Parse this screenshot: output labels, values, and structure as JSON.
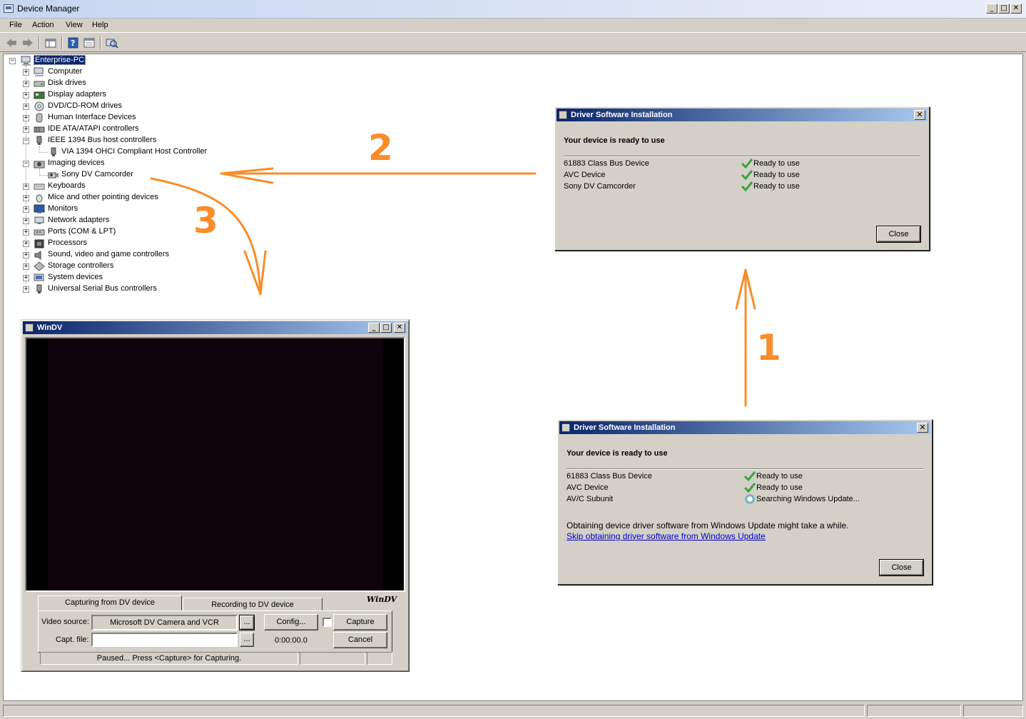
{
  "window": {
    "title": "Device Manager",
    "buttons": {
      "minimize": "_",
      "maximize": "□",
      "close": "✕"
    }
  },
  "menu": [
    "File",
    "Action",
    "View",
    "Help"
  ],
  "toolbar": [
    "back-icon",
    "forward-icon",
    "show-hide-tree-icon",
    "help-icon",
    "properties-icon",
    "scan-hardware-icon"
  ],
  "tree": {
    "root": "Enterprise-PC",
    "items": [
      {
        "label": "Computer",
        "icon": "computer-icon"
      },
      {
        "label": "Disk drives",
        "icon": "disk-drive-icon"
      },
      {
        "label": "Display adapters",
        "icon": "display-adapter-icon"
      },
      {
        "label": "DVD/CD-ROM drives",
        "icon": "dvd-drive-icon"
      },
      {
        "label": "Human Interface Devices",
        "icon": "hid-icon"
      },
      {
        "label": "IDE ATA/ATAPI controllers",
        "icon": "ide-controller-icon"
      },
      {
        "label": "IEEE 1394 Bus host controllers",
        "icon": "firewire-icon",
        "expanded": true,
        "children": [
          "VIA 1394 OHCI Compliant Host Controller"
        ]
      },
      {
        "label": "Imaging devices",
        "icon": "camera-icon",
        "expanded": true,
        "children": [
          "Sony DV Camcorder"
        ]
      },
      {
        "label": "Keyboards",
        "icon": "keyboard-icon"
      },
      {
        "label": "Mice and other pointing devices",
        "icon": "mouse-icon"
      },
      {
        "label": "Monitors",
        "icon": "monitor-icon"
      },
      {
        "label": "Network adapters",
        "icon": "network-icon"
      },
      {
        "label": "Ports (COM & LPT)",
        "icon": "port-icon"
      },
      {
        "label": "Processors",
        "icon": "processor-icon"
      },
      {
        "label": "Sound, video and game controllers",
        "icon": "speaker-icon"
      },
      {
        "label": "Storage controllers",
        "icon": "storage-icon"
      },
      {
        "label": "System devices",
        "icon": "system-icon"
      },
      {
        "label": "Universal Serial Bus controllers",
        "icon": "usb-icon"
      }
    ]
  },
  "dialog_top": {
    "title": "Driver Software Installation",
    "heading": "Your device is ready to use",
    "devices": [
      {
        "name": "61883 Class Bus Device",
        "status": "Ready to use"
      },
      {
        "name": "AVC Device",
        "status": "Ready to use"
      },
      {
        "name": "Sony DV Camcorder",
        "status": "Ready to use"
      }
    ],
    "close_label": "Close"
  },
  "dialog_bottom": {
    "title": "Driver Software Installation",
    "heading": "Your device is ready to use",
    "devices": [
      {
        "name": "61883 Class Bus Device",
        "status": "Ready to use"
      },
      {
        "name": "AVC Device",
        "status": "Ready to use"
      },
      {
        "name": "AV/C Subunit",
        "status": "Searching Windows Update..."
      }
    ],
    "message": "Obtaining device driver software from Windows Update might take a while.",
    "link": "Skip obtaining driver software from Windows Update",
    "close_label": "Close"
  },
  "windv": {
    "title": "WinDV",
    "logo": "WinDV",
    "tabs": [
      "Capturing from DV device",
      "Recording to DV device"
    ],
    "video_source_label": "Video source:",
    "video_source_value": "Microsoft DV Camera and VCR",
    "browse_label": "...",
    "capt_file_label": "Capt. file:",
    "capt_file_value": "",
    "config_label": "Config...",
    "timecode": "0:00:00.0",
    "capture_label": "Capture",
    "cancel_label": "Cancel",
    "status": "Paused... Press <Capture> for Capturing."
  },
  "annotations": [
    "1",
    "2",
    "3"
  ],
  "colors": {
    "annotation": "#fb8c2a",
    "title_active": "#0a246a",
    "selection": "#0a246a",
    "check": "#3da143"
  }
}
